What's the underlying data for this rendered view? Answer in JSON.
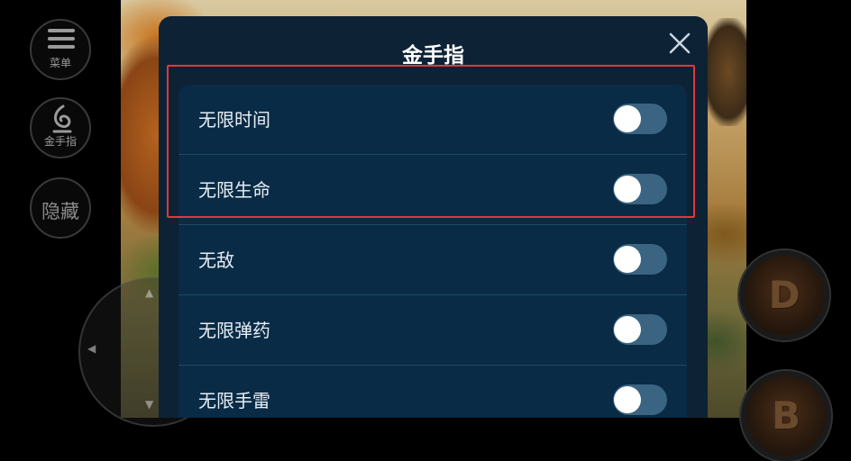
{
  "dialog": {
    "title": "金手指",
    "close_icon": "close-icon"
  },
  "cheats": [
    {
      "label": "无限时间",
      "enabled": false
    },
    {
      "label": "无限生命",
      "enabled": false
    },
    {
      "label": "无敌",
      "enabled": false
    },
    {
      "label": "无限弹药",
      "enabled": false
    },
    {
      "label": "无限手雷",
      "enabled": false
    }
  ],
  "side_buttons": {
    "menu_label": "菜单",
    "cheat_label": "金手指",
    "hide_label": "隐藏"
  },
  "action_buttons": {
    "d_label": "D",
    "b_label": "B"
  },
  "colors": {
    "dialog_bg": "#0e2235",
    "list_bg": "#0a2b45",
    "toggle_off": "#3a6481",
    "highlight": "#e0373d"
  }
}
